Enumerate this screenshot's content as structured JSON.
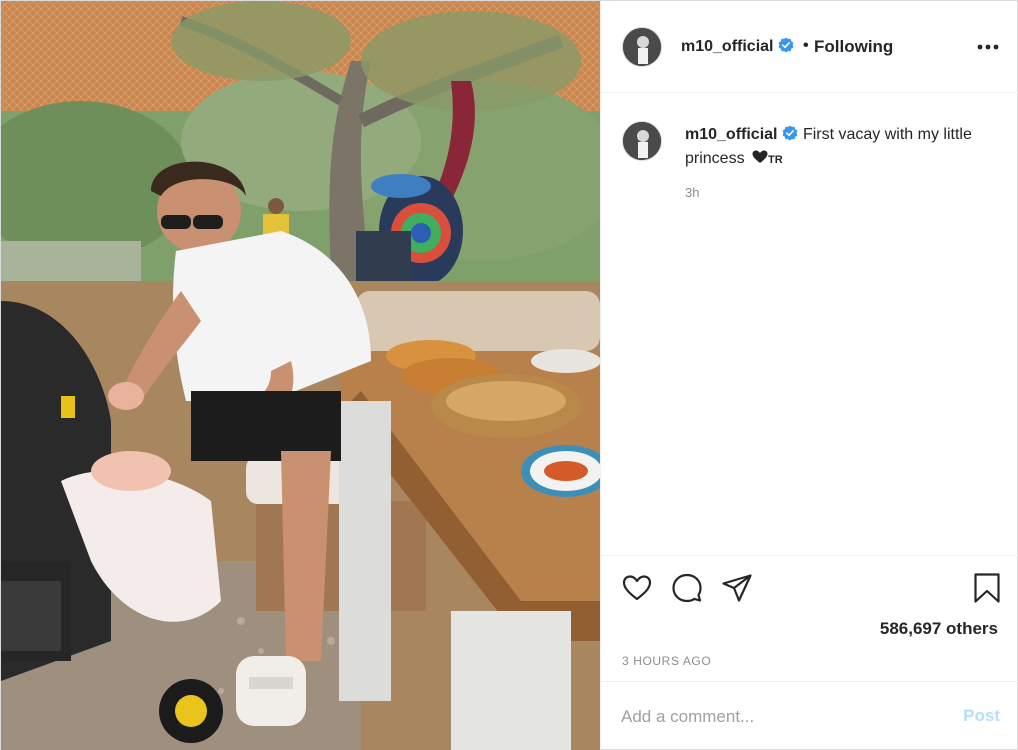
{
  "post": {
    "username": "m10_official",
    "verified": true,
    "follow_status": "Following",
    "separator": "•",
    "more_label": "•••"
  },
  "caption": {
    "username": "m10_official",
    "text": "First vacay with my little princess",
    "emoji_suffix": "TR",
    "time_ago": "3h"
  },
  "engagement": {
    "likes_text": "586,697 others",
    "posted_time": "3 HOURS AGO"
  },
  "comment": {
    "placeholder": "Add a comment...",
    "post_label": "Post"
  },
  "icons": {
    "like": "heart-icon",
    "comment": "comment-bubble-icon",
    "share": "paper-plane-icon",
    "save": "bookmark-icon",
    "verified": "verified-badge-icon",
    "more": "more-options-icon"
  },
  "colors": {
    "verified_blue": "#3897f0",
    "post_button_disabled": "#b2dffc",
    "secondary_text": "#8e8e8e",
    "border": "#efefef"
  }
}
